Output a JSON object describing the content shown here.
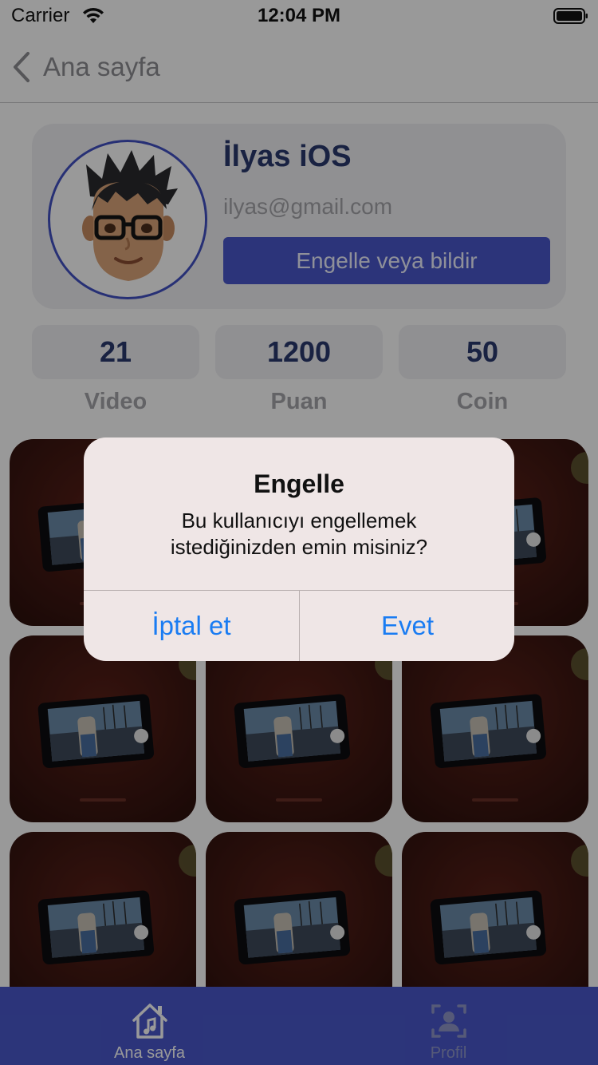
{
  "status_bar": {
    "carrier": "Carrier",
    "time": "12:04 PM"
  },
  "nav": {
    "back_label": "Ana sayfa"
  },
  "profile": {
    "name": "İlyas iOS",
    "email": "ilyas@gmail.com",
    "block_button": "Engelle veya bildir"
  },
  "stats": [
    {
      "value": "21",
      "label": "Video"
    },
    {
      "value": "1200",
      "label": "Puan"
    },
    {
      "value": "50",
      "label": "Coin"
    }
  ],
  "alert": {
    "title": "Engelle",
    "message_line1": "Bu kullanıcıyı engellemek",
    "message_line2": "istediğinizden emin misiniz?",
    "cancel": "İptal et",
    "confirm": "Evet"
  },
  "tab_bar": {
    "home_label": "Ana sayfa",
    "profile_label": "Profil",
    "home_icon": "home-music-icon",
    "profile_icon": "profile-icon"
  },
  "colors": {
    "accent": "#4a58cc",
    "alert_button": "#1a7cf2",
    "title_text": "#2a3a6e"
  }
}
